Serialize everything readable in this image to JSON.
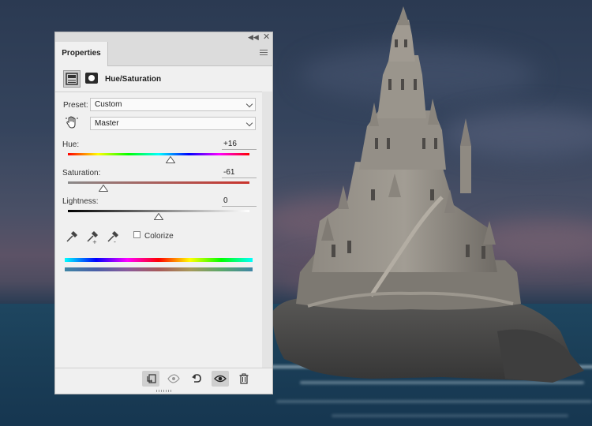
{
  "panel": {
    "tab_label": "Properties",
    "title": "Hue/Saturation",
    "preset_label": "Preset:",
    "preset_value": "Custom",
    "channel_value": "Master",
    "hue": {
      "label": "Hue:",
      "value": "+16",
      "fraction": 0.565
    },
    "saturation": {
      "label": "Saturation:",
      "value": "-61",
      "fraction": 0.195
    },
    "lightness": {
      "label": "Lightness:",
      "value": "0",
      "fraction": 0.5
    },
    "colorize_label": "Colorize",
    "colorize_checked": false
  },
  "icons": {
    "collapse": "double-chevron-icon",
    "close": "close-icon",
    "menu": "panel-menu-icon",
    "adjustment": "hue-saturation-adjustment-icon",
    "mask": "layer-mask-icon",
    "target": "targeted-adjustment-hand-icon",
    "eyedroppers": [
      "eyedropper-icon",
      "eyedropper-plus-icon",
      "eyedropper-minus-icon"
    ],
    "footer": [
      "clip-to-layer-icon",
      "view-previous-state-icon",
      "reset-icon",
      "visibility-eye-icon",
      "trash-icon"
    ]
  },
  "colors": {
    "panel_bg": "#f0f0f0",
    "saturation_end": "#c9332c"
  }
}
